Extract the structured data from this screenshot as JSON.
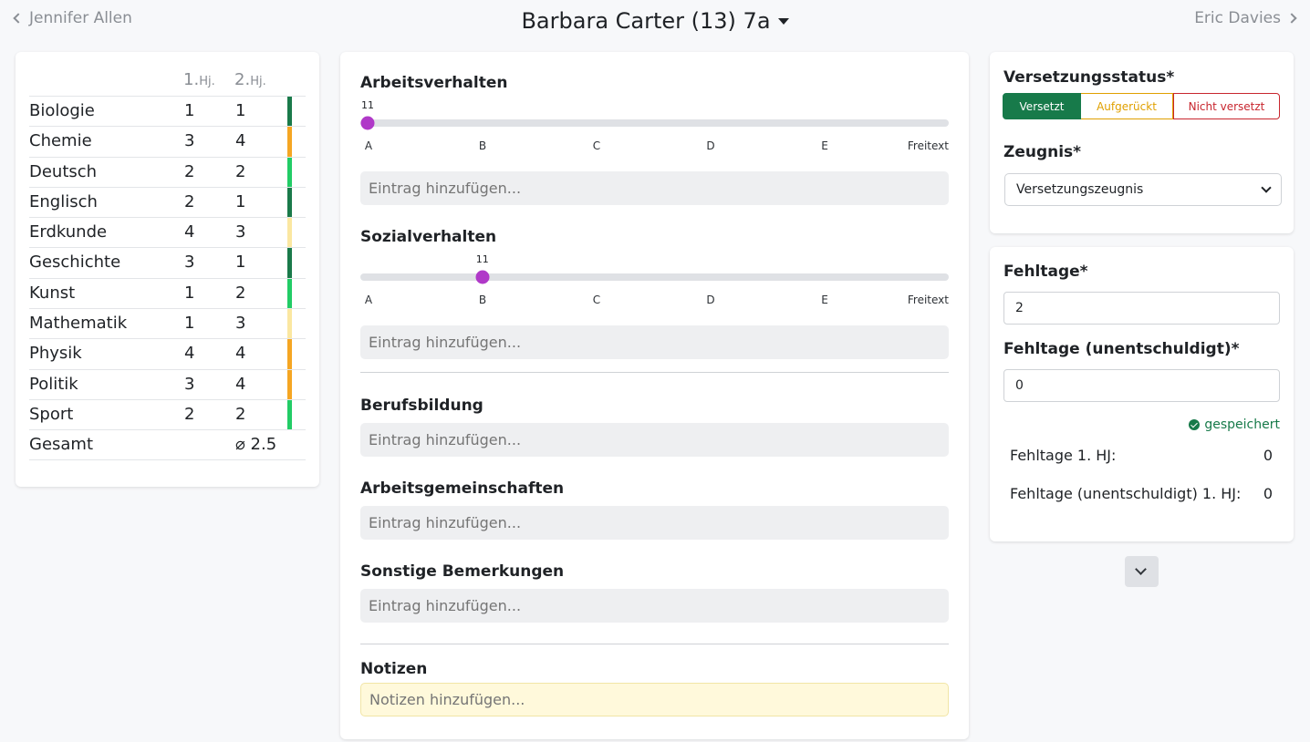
{
  "nav": {
    "prev_label": "Jennifer Allen",
    "next_label": "Eric Davies",
    "title": "Barbara Carter (13) 7a"
  },
  "grades": {
    "header_1": "1.",
    "header_1_small": "Hj.",
    "header_2": "2.",
    "header_2_small": "Hj.",
    "rows": [
      {
        "subject": "Biologie",
        "h1": "1",
        "h2": "1",
        "color": "#1a7a4a"
      },
      {
        "subject": "Chemie",
        "h1": "3",
        "h2": "4",
        "color": "#f5a623"
      },
      {
        "subject": "Deutsch",
        "h1": "2",
        "h2": "2",
        "color": "#22cc66"
      },
      {
        "subject": "Englisch",
        "h1": "2",
        "h2": "1",
        "color": "#1a7a4a"
      },
      {
        "subject": "Erdkunde",
        "h1": "4",
        "h2": "3",
        "color": "#fbe7a1"
      },
      {
        "subject": "Geschichte",
        "h1": "3",
        "h2": "1",
        "color": "#1a7a4a"
      },
      {
        "subject": "Kunst",
        "h1": "1",
        "h2": "2",
        "color": "#22cc66"
      },
      {
        "subject": "Mathematik",
        "h1": "1",
        "h2": "3",
        "color": "#fbe7a1"
      },
      {
        "subject": "Physik",
        "h1": "4",
        "h2": "4",
        "color": "#f5a623"
      },
      {
        "subject": "Politik",
        "h1": "3",
        "h2": "4",
        "color": "#f5a623"
      },
      {
        "subject": "Sport",
        "h1": "2",
        "h2": "2",
        "color": "#22cc66"
      }
    ],
    "total_label": "Gesamt",
    "total_value": "⌀ 2.5"
  },
  "behavior": {
    "arbeits": {
      "title": "Arbeitsverhalten",
      "value": "11",
      "level": 0,
      "placeholder": "Eintrag hinzufügen..."
    },
    "sozial": {
      "title": "Sozialverhalten",
      "value": "11",
      "level": 0.2,
      "placeholder": "Eintrag hinzufügen..."
    },
    "ticks": [
      "A",
      "B",
      "C",
      "D",
      "E",
      "Freitext"
    ]
  },
  "sections": {
    "beruf": {
      "title": "Berufsbildung",
      "placeholder": "Eintrag hinzufügen..."
    },
    "ag": {
      "title": "Arbeitsgemeinschaften",
      "placeholder": "Eintrag hinzufügen..."
    },
    "sonstige": {
      "title": "Sonstige Bemerkungen",
      "placeholder": "Eintrag hinzufügen..."
    },
    "notizen": {
      "title": "Notizen",
      "placeholder": "Notizen hinzufügen..."
    }
  },
  "status": {
    "label": "Versetzungsstatus*",
    "options": [
      "Versetzt",
      "Aufgerückt",
      "Nicht versetzt"
    ],
    "zeugnis_label": "Zeugnis*",
    "zeugnis_value": "Versetzungszeugnis"
  },
  "absence": {
    "fehltage_label": "Fehltage*",
    "fehltage_value": "2",
    "unent_label": "Fehltage (unentschuldigt)*",
    "unent_value": "0",
    "saved_label": "gespeichert",
    "hj1_label": "Fehltage 1. HJ:",
    "hj1_value": "0",
    "hj1_unent_label": "Fehltage (unentschuldigt) 1. HJ:",
    "hj1_unent_value": "0"
  }
}
